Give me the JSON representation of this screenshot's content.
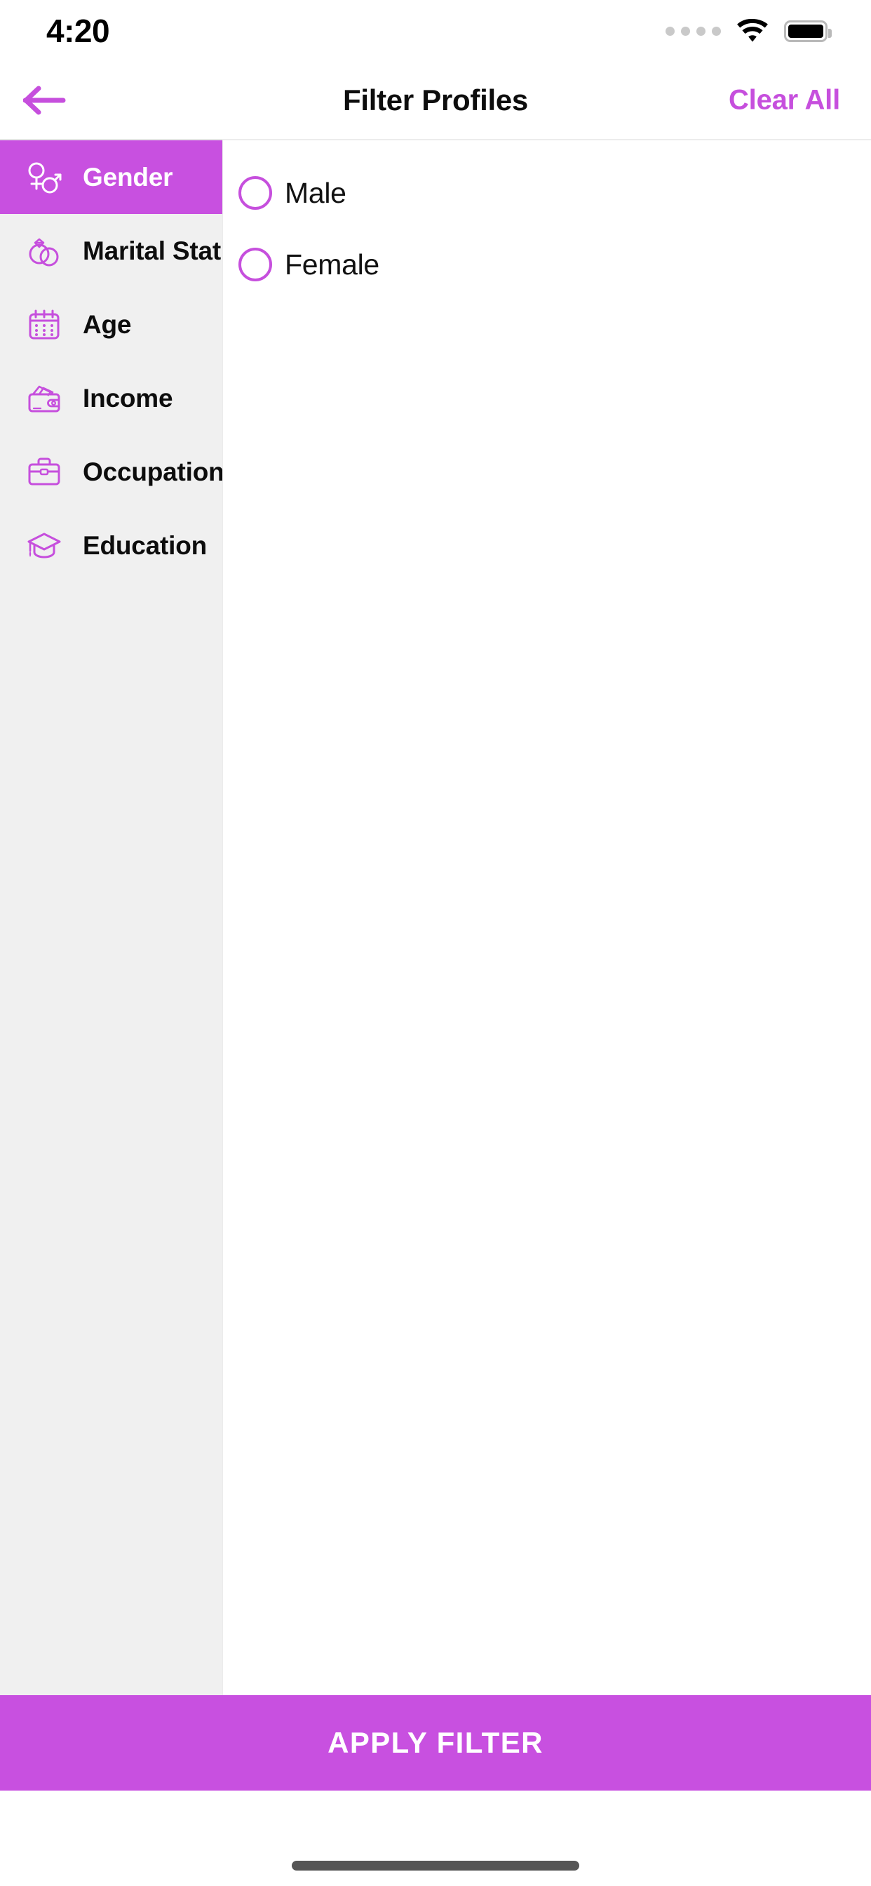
{
  "status_bar": {
    "time": "4:20",
    "signal_icon": "signal-dots-icon",
    "wifi_icon": "wifi-icon",
    "battery_icon": "battery-full-icon"
  },
  "header": {
    "back_icon": "arrow-left-icon",
    "title": "Filter Profiles",
    "clear_all_label": "Clear All"
  },
  "sidebar": {
    "items": [
      {
        "label": "Gender",
        "icon": "gender-symbols-icon",
        "active": true
      },
      {
        "label": "Marital Status",
        "icon": "wedding-rings-icon",
        "active": false
      },
      {
        "label": "Age",
        "icon": "calendar-icon",
        "active": false
      },
      {
        "label": "Income",
        "icon": "wallet-icon",
        "active": false
      },
      {
        "label": "Occupation",
        "icon": "briefcase-icon",
        "active": false
      },
      {
        "label": "Education",
        "icon": "graduation-cap-icon",
        "active": false
      }
    ]
  },
  "panel": {
    "active_filter": "Gender",
    "options": [
      {
        "label": "Male",
        "selected": false
      },
      {
        "label": "Female",
        "selected": false
      }
    ]
  },
  "footer": {
    "apply_label": "APPLY FILTER"
  },
  "colors": {
    "accent": "#c850e0",
    "accent_text": "#c64fdd",
    "sidebar_bg": "#f0f0f0",
    "panel_bg": "#ffffff",
    "text_primary": "#0d0d0d"
  }
}
